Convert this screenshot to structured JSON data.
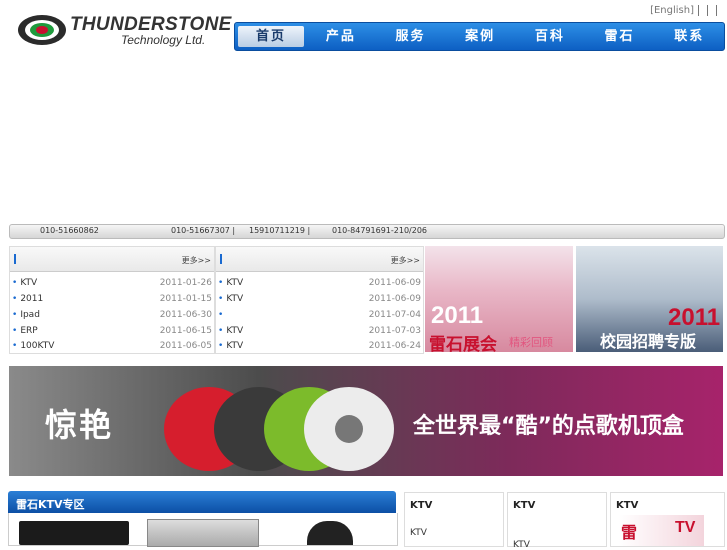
{
  "logo": {
    "word": "THUNDERSTONE",
    "sub": "Technology Ltd."
  },
  "toplinks": [
    "[English]",
    "",
    "",
    ""
  ],
  "nav": {
    "items": [
      "首页",
      "产品",
      "服务",
      "案例",
      "百科",
      "雷石",
      "联系"
    ]
  },
  "phonebar": {
    "phone1": "010-51660862",
    "mid": "",
    "phone2": "010-51667307 |",
    "phone3": "15910711219 |",
    "phone4": "010-84791691-210/206"
  },
  "news_left": {
    "title": "",
    "more": "更多>>",
    "rows": [
      {
        "text": "KTV",
        "date": "2011-01-26"
      },
      {
        "text": "2011",
        "date": "2011-01-15"
      },
      {
        "text": "Ipad",
        "date": "2011-06-30"
      },
      {
        "text": "ERP",
        "date": "2011-06-15"
      },
      {
        "text": "100KTV",
        "date": "2011-06-05"
      }
    ]
  },
  "news_right": {
    "title": "",
    "more": "更多>>",
    "rows": [
      {
        "text": "KTV",
        "date": "2011-06-09"
      },
      {
        "text": "KTV",
        "date": "2011-06-09"
      },
      {
        "text": "",
        "date": "2011-07-04"
      },
      {
        "text": "KTV",
        "date": "2011-07-03"
      },
      {
        "text": "KTV",
        "date": "2011-06-24"
      }
    ]
  },
  "banner1": {
    "year": "2011",
    "label": "雷石展会",
    "sub": "精彩回顾"
  },
  "banner2": {
    "year": "2011",
    "label": "校园招聘专版"
  },
  "bigbanner": {
    "left": "惊艳",
    "right": "全世界最“酷”的点歌机顶盒"
  },
  "ktv_zone": {
    "title": "雷石KTV专区"
  },
  "columns": [
    {
      "head": "KTV",
      "line1": "KTV",
      "line2": ""
    },
    {
      "head": "KTV",
      "line1": "",
      "line2": "KTV"
    },
    {
      "head": "KTV",
      "line1": "",
      "line2": ""
    }
  ],
  "colors": {
    "nav_blue": "#1470d4",
    "accent_red": "#c8102e"
  }
}
